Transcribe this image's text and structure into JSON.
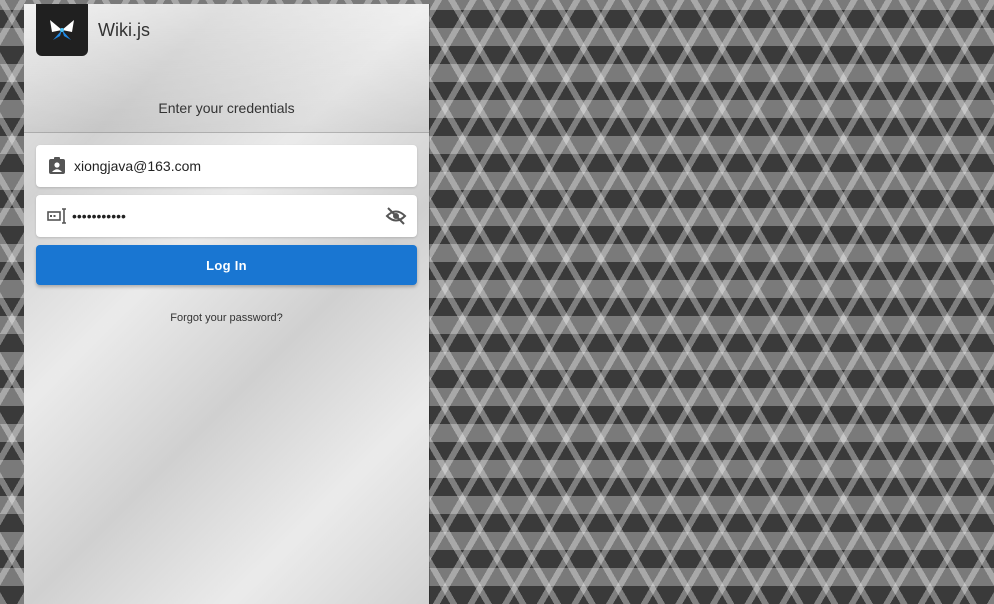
{
  "app": {
    "title": "Wiki.js"
  },
  "login": {
    "subtitle": "Enter your credentials",
    "email_value": "xiongjava@163.com",
    "password_value": "•••••••••••",
    "login_label": "Log In",
    "forgot_label": "Forgot your password?"
  },
  "colors": {
    "primary": "#1976d2",
    "logo_bg": "#202020"
  },
  "icons": {
    "logo": "wikijs-logo",
    "email": "account-box-icon",
    "password": "form-textbox-password-icon",
    "toggle": "eye-off-icon"
  }
}
